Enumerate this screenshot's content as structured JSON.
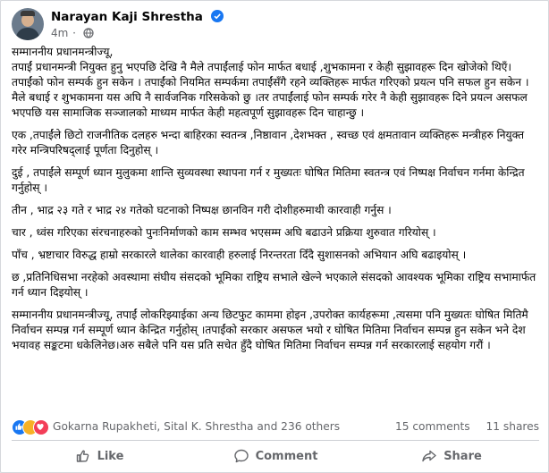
{
  "post": {
    "author": "Narayan Kaji Shrestha",
    "time": "4m",
    "paragraphs": [
      "सम्माननीय प्रधानमन्त्रीज्यू,\nतपाईं प्रधानमन्त्री नियुक्त हुनु भएपछि देखि नै मैले तपाईंलाई फोन मार्फत बधाई ,शुभकामना र केही सुझावहरू दिन खोजेको थिएँ। तपाईंको फोन सम्पर्क हुन सकेन । तपाईंको नियमित सम्पर्कमा तपाईंसँगै रहने व्यक्तिहरू मार्फत गरिएको प्रयत्न पनि सफल हुन सकेन । मैले बधाई र शुभकामना यस अघि नै सार्वजनिक गरिसकेको छु ।तर तपाईंलाई फोन सम्पर्क गरेर नै केही सुझावहरू दिने प्रयत्न असफल भएपछि यस सामाजिक सञ्जालको  माध्यम मार्फत केही महत्वपूर्ण सुझावहरू दिन चाहान्छु ।",
      "एक ,तपाईंले छिटो राजनीतिक दलहरु भन्दा बाहिरका स्वतन्त्र ,निष्ठावान ,देशभक्त , स्वच्छ एवं क्षमतावान व्यक्तिहरू मन्त्रीहरु नियुक्त गरेर मन्त्रिपरिषद्लाई पूर्णता दिनुहोस् ।",
      "दुई , तपाईंले सम्पूर्ण ध्यान मुलुकमा शान्ति सुव्यवस्था स्थापना गर्न र मुख्यतः घोषित मितिमा स्वतन्त्र एवं निष्पक्ष निर्वाचन गर्नमा केन्द्रित गर्नुहोस् ।",
      "तीन , भाद्र २३ गते र भाद्र २४ गतेको घटनाको निष्पक्ष छानविन गरी दोशीहरुमाथी कारवाही गर्नुस ।",
      "चार , ध्वंस गरिएका संरचनाहरुको पुनःनिर्माणको काम सम्भव भएसम्म अघि बढाउने प्रक्रिया शुरुवात गरियोस् ।",
      "पाँच , भ्रष्टाचार विरुद्ध हाम्रो सरकारले थालेका कारवाही हरुलाई निरन्तरता दिँदै सुशासनको अभियान अघि बढाइयोस् ।",
      "छ ,प्रतिनिधिसभा नरहेको अवस्थामा संघीय संसदको भूमिका राष्ट्रिय सभाले खेल्ने भएकाले संसदको आवश्यक भूमिका राष्ट्रिय सभामार्फत गर्न ध्यान दिइयोस् ।",
      "सम्माननीय प्रधानमन्त्रीज्यू, तपाईं लोकरिझ्याईका अन्य छिटफुट काममा होइन ,उपरोक्त कार्यहरूमा ,त्यसमा पनि मुख्यतः घोषित मितिमै निर्वाचन सम्पन्न गर्न सम्पूर्ण ध्यान केन्द्रित गर्नुहोस् ।तपाईंको सरकार असफल भयो र घोषित मितिमा निर्वाचन सम्पन्न हुन सकेन भने देश भयावह सङ्कटमा धकेलिनेछ।अरु सबैले पनि यस प्रति सचेत हुँदै घोषित मितिमा निर्वाचन सम्पन्न गर्न सरकारलाई सहयोग गरौं ।"
    ],
    "reactions_text": "Gokarna Rupakheti, Sital K. Shrestha and 236 others",
    "comments_count": "15 comments",
    "shares_count": "11 shares",
    "actions": {
      "like": "Like",
      "comment": "Comment",
      "share": "Share"
    },
    "colors": {
      "brand": "#1877f2",
      "secondary_text": "#65676b"
    },
    "icons": [
      "verified-badge-icon",
      "globe-icon",
      "like-reaction-icon",
      "care-reaction-icon",
      "love-reaction-icon",
      "thumbs-up-icon",
      "comment-icon",
      "share-icon"
    ]
  }
}
